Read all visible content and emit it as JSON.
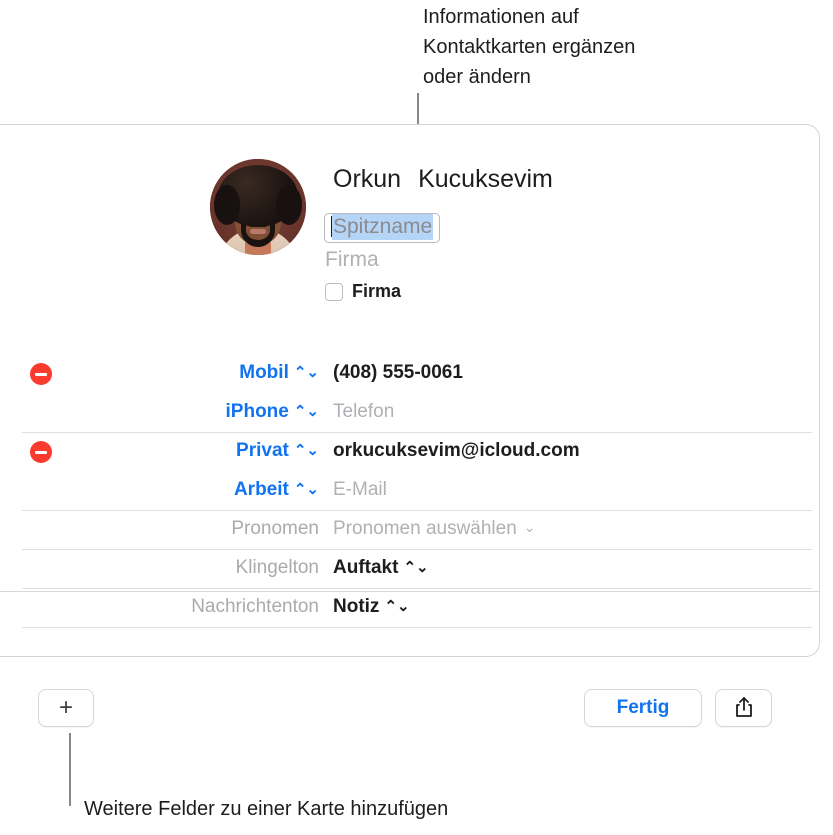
{
  "callouts": {
    "top": "Informationen auf\nKontaktkarten ergänzen\noder ändern",
    "bottom": "Weitere Felder zu einer Karte hinzufügen"
  },
  "card": {
    "avatar_alt": "contact-photo",
    "name": {
      "first": "Orkun",
      "last": "Kucuksevim"
    },
    "nickname_field": {
      "placeholder": "Spitzname",
      "selected": true
    },
    "company_placeholder": "Firma",
    "company_checkbox": {
      "label": "Firma",
      "checked": false
    },
    "rows": [
      {
        "id": "phone-mobile",
        "label": "Mobil",
        "label_style": "blue",
        "label_control": "stepper",
        "value": "(408) 555-0061",
        "value_style": "dark",
        "value_control": "none",
        "deletable": true,
        "separator_above": false
      },
      {
        "id": "phone-iphone",
        "label": "iPhone",
        "label_style": "blue",
        "label_control": "stepper",
        "value": "Telefon",
        "value_style": "muted",
        "value_control": "none",
        "deletable": false,
        "separator_above": false
      },
      {
        "id": "email-home",
        "label": "Privat",
        "label_style": "blue",
        "label_control": "stepper",
        "value": "orkucuksevim@icloud.com",
        "value_style": "dark",
        "value_control": "none",
        "deletable": true,
        "separator_above": true
      },
      {
        "id": "email-work",
        "label": "Arbeit",
        "label_style": "blue",
        "label_control": "stepper",
        "value": "E-Mail",
        "value_style": "muted",
        "value_control": "none",
        "deletable": false,
        "separator_above": false
      },
      {
        "id": "pronouns",
        "label": "Pronomen",
        "label_style": "gray",
        "label_control": "none",
        "value": "Pronomen auswählen",
        "value_style": "muted",
        "value_control": "chevron",
        "deletable": false,
        "separator_above": true
      },
      {
        "id": "ringtone",
        "label": "Klingelton",
        "label_style": "gray",
        "label_control": "none",
        "value": "Auftakt",
        "value_style": "plain",
        "value_control": "stepper",
        "deletable": false,
        "separator_above": true
      },
      {
        "id": "text-tone",
        "label": "Nachrichtenton",
        "label_style": "gray",
        "label_control": "none",
        "value": "Notiz",
        "value_style": "plain",
        "value_control": "stepper",
        "deletable": false,
        "separator_above": true
      }
    ],
    "footer": {
      "add_label": "+",
      "done_label": "Fertig",
      "share_icon": "share-export-icon"
    }
  },
  "colors": {
    "accent_blue": "#1273f0",
    "delete_red": "#fb3b30",
    "placeholder_gray": "#b0b0b5",
    "selection_blue": "#b4d5f5",
    "border_gray": "#d2d2d7",
    "separator_gray": "#e0e0e3"
  }
}
